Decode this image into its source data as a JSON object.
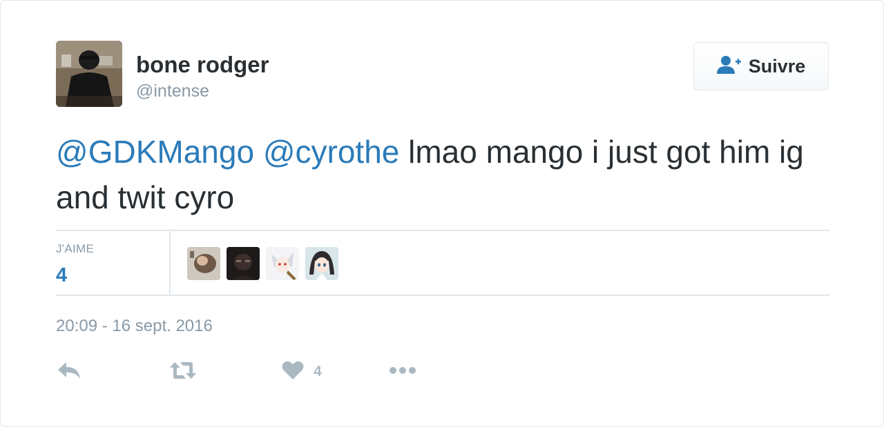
{
  "user": {
    "display_name": "bone rodger",
    "screen_name": "@intense"
  },
  "follow_button": {
    "label": "Suivre",
    "icon": "add-user-icon"
  },
  "tweet": {
    "mention_1": "@GDKMango",
    "mention_2": "@cyrothe",
    "text": " lmao mango i just got him ig and twit cyro"
  },
  "stats": {
    "likes_label": "J'AIME",
    "likes_count": "4"
  },
  "timestamp": "20:09 - 16 sept. 2016",
  "actions": {
    "reply_icon": "reply-icon",
    "retweet_icon": "retweet-icon",
    "like_icon": "heart-icon",
    "like_count": "4",
    "more_icon": "more-dots-icon"
  },
  "colors": {
    "accent": "#2b7bb9",
    "text": "#292f33",
    "muted": "#8899a6",
    "action_gray": "#aab8c2",
    "border": "#e1e8ed"
  }
}
